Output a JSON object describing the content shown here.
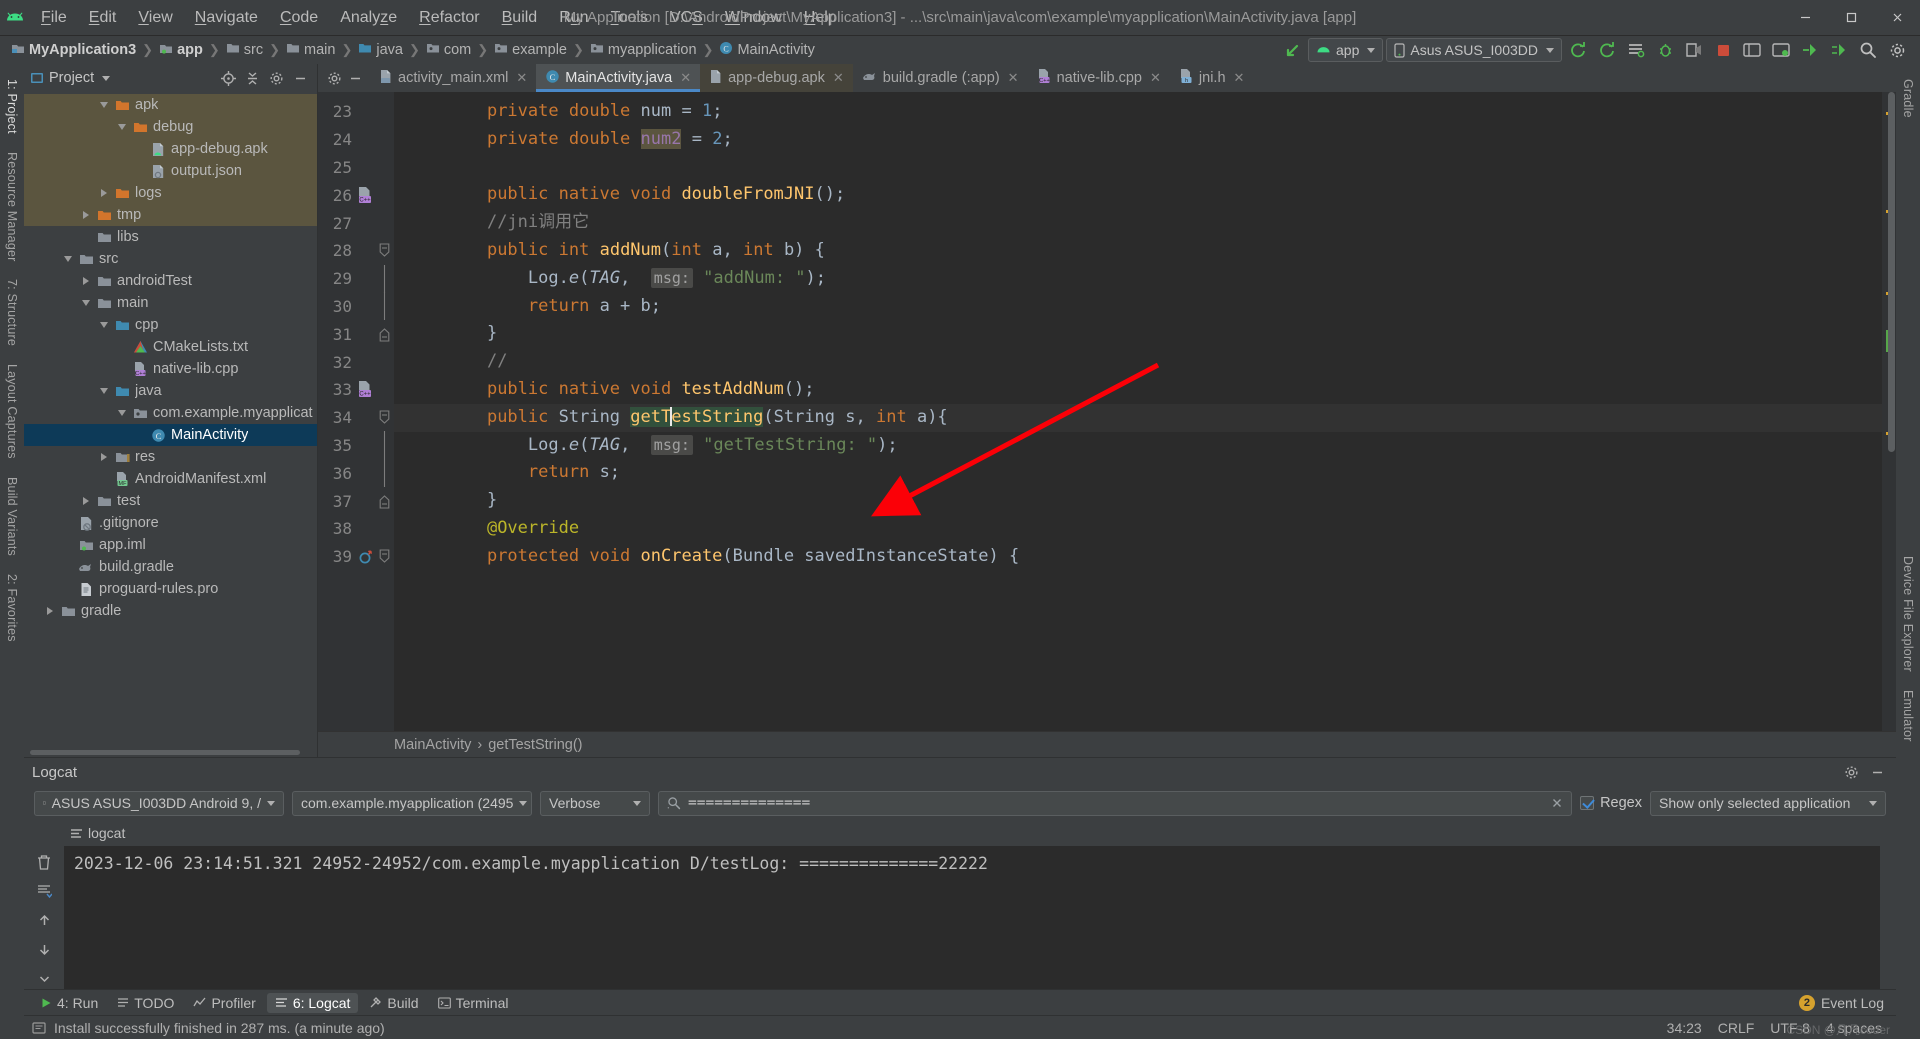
{
  "window": {
    "title": "My Application [D:\\AndroidProject\\MyApplication3] - ...\\src\\main\\java\\com\\example\\myapplication\\MainActivity.java [app]",
    "minimize": "—",
    "maximize": "❑",
    "close": "✕"
  },
  "menu": [
    {
      "label": "File",
      "mnemonic": "F"
    },
    {
      "label": "Edit",
      "mnemonic": "E"
    },
    {
      "label": "View",
      "mnemonic": "V"
    },
    {
      "label": "Navigate",
      "mnemonic": "N"
    },
    {
      "label": "Code",
      "mnemonic": "C"
    },
    {
      "label": "Analyze",
      "mnemonic": "z"
    },
    {
      "label": "Refactor",
      "mnemonic": "R"
    },
    {
      "label": "Build",
      "mnemonic": "B"
    },
    {
      "label": "Run",
      "mnemonic": "u"
    },
    {
      "label": "Tools",
      "mnemonic": "T"
    },
    {
      "label": "VCS",
      "mnemonic": "S"
    },
    {
      "label": "Window",
      "mnemonic": "W"
    },
    {
      "label": "Help",
      "mnemonic": "H"
    }
  ],
  "navbar": {
    "crumbs": [
      {
        "label": "MyApplication3",
        "icon": "module-icon",
        "bold": true
      },
      {
        "label": "app",
        "icon": "app-module-icon",
        "bold": true
      },
      {
        "label": "src",
        "icon": "folder-icon",
        "bold": false
      },
      {
        "label": "main",
        "icon": "folder-icon",
        "bold": false
      },
      {
        "label": "java",
        "icon": "source-folder-icon",
        "bold": false
      },
      {
        "label": "com",
        "icon": "package-icon",
        "bold": false
      },
      {
        "label": "example",
        "icon": "package-icon",
        "bold": false
      },
      {
        "label": "myapplication",
        "icon": "package-icon",
        "bold": false
      },
      {
        "label": "MainActivity",
        "icon": "class-icon",
        "bold": false
      }
    ],
    "run_config": "app",
    "device": "Asus ASUS_I003DD",
    "icons": [
      "make-project-icon",
      "sync-gradle-icon",
      "avd-manager-icon",
      "sdk-manager-icon",
      "run-icon",
      "debug-icon",
      "run-coverage-icon",
      "profiler-icon",
      "stop-icon",
      "layout-inspector-icon",
      "attach-debugger-icon",
      "apply-changes-icon",
      "apply-code-changes-icon",
      "search-everywhere-icon",
      "settings-icon"
    ]
  },
  "rails": {
    "left": [
      "1: Project",
      "Resource Manager",
      "7: Structure",
      "Layout Captures",
      "Build Variants",
      "2: Favorites"
    ],
    "right": [
      "Gradle",
      "Device File Explorer",
      "Emulator"
    ]
  },
  "project_panel": {
    "title": "Project",
    "header_icons": [
      "locate-icon",
      "collapse-all-icon",
      "settings-icon",
      "hide-icon"
    ],
    "tree": [
      {
        "label": "apk",
        "indent": 4,
        "arrow": "open",
        "icon": "folder-orange-icon",
        "state": "hl"
      },
      {
        "label": "debug",
        "indent": 5,
        "arrow": "open",
        "icon": "folder-orange-icon",
        "state": "hl"
      },
      {
        "label": "app-debug.apk",
        "indent": 6,
        "arrow": "none",
        "icon": "apk-icon",
        "state": "hl"
      },
      {
        "label": "output.json",
        "indent": 6,
        "arrow": "none",
        "icon": "json-icon",
        "state": "hl"
      },
      {
        "label": "logs",
        "indent": 4,
        "arrow": "close",
        "icon": "folder-orange-icon",
        "state": "hl"
      },
      {
        "label": "tmp",
        "indent": 3,
        "arrow": "close",
        "icon": "folder-orange-icon",
        "state": "hl"
      },
      {
        "label": "libs",
        "indent": 3,
        "arrow": "none",
        "icon": "folder-icon",
        "state": ""
      },
      {
        "label": "src",
        "indent": 2,
        "arrow": "open",
        "icon": "folder-icon",
        "state": ""
      },
      {
        "label": "androidTest",
        "indent": 3,
        "arrow": "close",
        "icon": "folder-icon",
        "state": ""
      },
      {
        "label": "main",
        "indent": 3,
        "arrow": "open",
        "icon": "folder-icon",
        "state": ""
      },
      {
        "label": "cpp",
        "indent": 4,
        "arrow": "open",
        "icon": "source-folder-icon",
        "state": ""
      },
      {
        "label": "CMakeLists.txt",
        "indent": 5,
        "arrow": "none",
        "icon": "cmake-icon",
        "state": ""
      },
      {
        "label": "native-lib.cpp",
        "indent": 5,
        "arrow": "none",
        "icon": "cpp-file-icon",
        "state": ""
      },
      {
        "label": "java",
        "indent": 4,
        "arrow": "open",
        "icon": "source-folder-icon",
        "state": ""
      },
      {
        "label": "com.example.myapplicatio",
        "indent": 5,
        "arrow": "open",
        "icon": "package-icon",
        "state": ""
      },
      {
        "label": "MainActivity",
        "indent": 6,
        "arrow": "none",
        "icon": "class-icon",
        "state": "sel"
      },
      {
        "label": "res",
        "indent": 4,
        "arrow": "close",
        "icon": "res-folder-icon",
        "state": ""
      },
      {
        "label": "AndroidManifest.xml",
        "indent": 4,
        "arrow": "none",
        "icon": "manifest-icon",
        "state": ""
      },
      {
        "label": "test",
        "indent": 3,
        "arrow": "close",
        "icon": "folder-icon",
        "state": ""
      },
      {
        "label": ".gitignore",
        "indent": 2,
        "arrow": "none",
        "icon": "gitignore-icon",
        "state": ""
      },
      {
        "label": "app.iml",
        "indent": 2,
        "arrow": "none",
        "icon": "iml-icon",
        "state": ""
      },
      {
        "label": "build.gradle",
        "indent": 2,
        "arrow": "none",
        "icon": "gradle-icon",
        "state": ""
      },
      {
        "label": "proguard-rules.pro",
        "indent": 2,
        "arrow": "none",
        "icon": "proguard-icon",
        "state": ""
      },
      {
        "label": "gradle",
        "indent": 1,
        "arrow": "close",
        "icon": "folder-icon",
        "state": ""
      }
    ]
  },
  "editor": {
    "tabs": [
      {
        "label": "activity_main.xml",
        "icon": "xml-file-icon",
        "active": false,
        "dim": false
      },
      {
        "label": "MainActivity.java",
        "icon": "java-class-icon",
        "active": true,
        "dim": false
      },
      {
        "label": "app-debug.apk",
        "icon": "apk-file-icon",
        "active": false,
        "dim": true
      },
      {
        "label": "build.gradle (:app)",
        "icon": "gradle-file-icon",
        "active": false,
        "dim": false
      },
      {
        "label": "native-lib.cpp",
        "icon": "cpp-file-icon",
        "active": false,
        "dim": false
      },
      {
        "label": "jni.h",
        "icon": "header-file-icon",
        "active": false,
        "dim": false
      }
    ],
    "first_line": 23,
    "lines": [
      {
        "n": 23,
        "marker": "",
        "fold": "",
        "html": "    <span class=\"kw\">private</span> <span class=\"kw\">double</span> <span class=\"id\">num</span> <span class=\"id\">=</span> <span class=\"num2\">1</span><span class=\"id\">;</span>",
        "text": "private double num = 1;"
      },
      {
        "n": 24,
        "marker": "",
        "fold": "",
        "html": "    <span class=\"kw\">private</span> <span class=\"kw\">double</span> <span class=\"fld hlbox\">num2</span> <span class=\"id\">=</span> <span class=\"num2\">2</span><span class=\"id\">;</span>",
        "text": "private double num2 = 2;"
      },
      {
        "n": 25,
        "marker": "",
        "fold": "",
        "html": "",
        "text": ""
      },
      {
        "n": 26,
        "marker": "cpp",
        "fold": "",
        "html": "    <span class=\"kw\">public native void</span> <span class=\"fn\">doubleFromJNI</span><span class=\"id\">();</span>",
        "text": "public native void doubleFromJNI();"
      },
      {
        "n": 27,
        "marker": "",
        "fold": "",
        "html": "    <span class=\"cmt\">//jni调用它</span>",
        "text": "//jni调用它"
      },
      {
        "n": 28,
        "marker": "",
        "fold": "minus",
        "html": "    <span class=\"kw\">public</span> <span class=\"kw\">int</span> <span class=\"fn\">addNum</span><span class=\"id\">(</span><span class=\"kw\">int</span> <span class=\"id\">a,</span> <span class=\"kw\">int</span> <span class=\"id\">b) {</span>",
        "text": "public int addNum(int a, int b) {"
      },
      {
        "n": 29,
        "marker": "",
        "fold": "bar",
        "html": "        <span class=\"id\">Log.</span><span class=\"stat\">e</span><span class=\"id\">(</span><span class=\"stat fld\">TAG</span><span class=\"id\">,</span>  <span class=\"hint\">msg:</span> <span class=\"str\">\"addNum: \"</span><span class=\"id\">);</span>",
        "text": "Log.e(TAG, msg: \"addNum: \");"
      },
      {
        "n": 30,
        "marker": "",
        "fold": "bar",
        "html": "        <span class=\"kw\">return</span> <span class=\"id\">a + b;</span>",
        "text": "return a + b;"
      },
      {
        "n": 31,
        "marker": "",
        "fold": "end",
        "html": "    <span class=\"id\">}</span>",
        "text": "}"
      },
      {
        "n": 32,
        "marker": "",
        "fold": "",
        "html": "    <span class=\"cmt\">//</span>",
        "text": "//"
      },
      {
        "n": 33,
        "marker": "cpp",
        "fold": "",
        "html": "    <span class=\"kw\">public native void</span> <span class=\"fn\">testAddNum</span><span class=\"id\">();</span>",
        "text": "public native void testAddNum();"
      },
      {
        "n": 34,
        "marker": "",
        "fold": "minus",
        "html": "    <span class=\"kw\">public</span> <span class=\"id\">String</span> <span class=\"fn greenbox\">getT<span class=\"caret-bar\"></span>estString</span><span class=\"id\">(String s,</span> <span class=\"kw\">int</span> <span class=\"id\">a){</span>",
        "text": "public String getTestString(String s, int a){",
        "current": true
      },
      {
        "n": 35,
        "marker": "",
        "fold": "bar",
        "html": "        <span class=\"id\">Log.</span><span class=\"stat\">e</span><span class=\"id\">(</span><span class=\"stat fld\">TAG</span><span class=\"id\">,</span>  <span class=\"hint\">msg:</span> <span class=\"str\">\"getTestString: \"</span><span class=\"id\">);</span>",
        "text": "Log.e(TAG, msg: \"getTestString: \");"
      },
      {
        "n": 36,
        "marker": "",
        "fold": "bar",
        "html": "        <span class=\"kw\">return</span> <span class=\"id\">s;</span>",
        "text": "return s;"
      },
      {
        "n": 37,
        "marker": "",
        "fold": "end",
        "html": "    <span class=\"id\">}</span>",
        "text": "}"
      },
      {
        "n": 38,
        "marker": "",
        "fold": "",
        "html": "    <span class=\"ann\">@Override</span>",
        "text": "@Override"
      },
      {
        "n": 39,
        "marker": "override",
        "fold": "minus",
        "html": "    <span class=\"kw\">protected</span> <span class=\"kw\">void</span> <span class=\"fn\">onCreate</span><span class=\"id\">(Bundle savedInstanceState) {</span>",
        "text": "protected void onCreate(Bundle savedInstanceState) {"
      }
    ],
    "breadcrumb": [
      "MainActivity",
      "getTestString()"
    ],
    "breadcrumb_sep": "›"
  },
  "logcat": {
    "title": "Logcat",
    "device": "ASUS ASUS_I003DD Android 9, /",
    "process": "com.example.myapplication (2495",
    "process_bold": "myapplication",
    "level": "Verbose",
    "search_value": "==============",
    "search_placeholder": "",
    "regex_label": "Regex",
    "regex_checked": true,
    "scope": "Show only selected application",
    "subtab": "logcat",
    "lines": [
      "2023-12-06 23:14:51.321 24952-24952/com.example.myapplication D/testLog: ==============22222"
    ],
    "tools": [
      "clear-logcat-icon",
      "scroll-to-end-icon",
      "up-icon",
      "down-icon",
      "more-icon"
    ],
    "head_icons": [
      "settings-icon",
      "hide-icon"
    ]
  },
  "bottom_bar": {
    "items": [
      {
        "label": "4: Run",
        "mnemonic": "4",
        "icon": "run-icon",
        "active": false
      },
      {
        "label": "TODO",
        "mnemonic": "",
        "icon": "todo-icon",
        "active": false
      },
      {
        "label": "Profiler",
        "mnemonic": "",
        "icon": "profiler-icon",
        "active": false
      },
      {
        "label": "6: Logcat",
        "mnemonic": "6",
        "icon": "logcat-icon",
        "active": true
      },
      {
        "label": "Build",
        "mnemonic": "",
        "icon": "build-icon",
        "active": false
      },
      {
        "label": "Terminal",
        "mnemonic": "",
        "icon": "terminal-icon",
        "active": false
      }
    ],
    "event_log": "Event Log",
    "event_log_badge": "2"
  },
  "statusbar": {
    "message": "Install successfully finished in 287 ms. (a minute ago)",
    "caret": "34:23",
    "line_sep": "CRLF",
    "encoding": "UTF-8",
    "indent": "4 spaces",
    "watermark": "CSDN @凡凡coder"
  },
  "colors": {
    "accent": "#4a88c7",
    "selection": "#0d3a58",
    "highlight": "#5b553f",
    "arrow": "#fb0007",
    "editor_bg": "#2b2b2b",
    "panel_bg": "#3c3f41"
  }
}
